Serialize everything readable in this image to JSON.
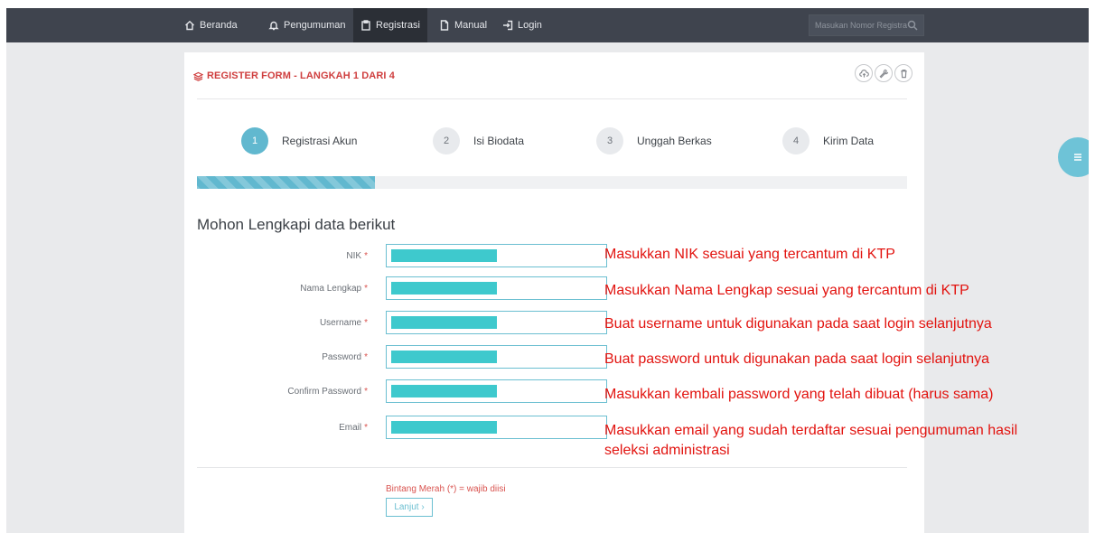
{
  "nav": {
    "items": [
      {
        "label": "Beranda",
        "icon": "home-icon"
      },
      {
        "label": "Pengumuman",
        "icon": "bell-icon"
      },
      {
        "label": "Registrasi",
        "icon": "clipboard-icon",
        "active": true
      },
      {
        "label": "Manual",
        "icon": "document-icon"
      },
      {
        "label": "Login",
        "icon": "login-icon"
      }
    ],
    "search_placeholder": "Masukan Nomor Registrasi"
  },
  "card": {
    "title": "REGISTER FORM - LANGKAH 1 DARI 4",
    "title_icon": "layers-icon",
    "tool_icons": [
      "cloud-upload-icon",
      "wrench-icon",
      "trash-icon"
    ]
  },
  "steps": [
    {
      "number": "1",
      "label": "Registrasi Akun",
      "active": true
    },
    {
      "number": "2",
      "label": "Isi Biodata",
      "active": false
    },
    {
      "number": "3",
      "label": "Unggah Berkas",
      "active": false
    },
    {
      "number": "4",
      "label": "Kirim Data",
      "active": false
    }
  ],
  "progress": 0.25,
  "form": {
    "heading": "Mohon Lengkapi data berikut",
    "fields": [
      {
        "label": "NIK",
        "required": "*",
        "value": ""
      },
      {
        "label": "Nama Lengkap",
        "required": "*",
        "value": ""
      },
      {
        "label": "Username",
        "required": "*",
        "value": ""
      },
      {
        "label": "Password",
        "required": "*",
        "value": ""
      },
      {
        "label": "Confirm Password",
        "required": "*",
        "value": ""
      },
      {
        "label": "Email",
        "required": "*",
        "value": ""
      }
    ],
    "required_note": "Bintang Merah (*) = wajib diisi",
    "next_label": "Lanjut ›"
  },
  "annotations": [
    "Masukkan NIK sesuai yang tercantum di KTP",
    "Masukkan Nama Lengkap sesuai yang tercantum di KTP",
    "Buat username untuk digunakan pada saat login selanjutnya",
    "Buat password untuk digunakan pada saat login selanjutnya",
    "Masukkan kembali password yang telah dibuat (harus sama)",
    "Masukkan email yang sudah terdaftar sesuai pengumuman hasil",
    "seleksi administrasi"
  ],
  "colors": {
    "nav_bg": "#3f444e",
    "accent": "#61b8cf",
    "title_red": "#cf3e3e",
    "annotation_red": "#e2130f",
    "redaction": "#3ec9cd"
  },
  "fab_icon": "menu-icon"
}
